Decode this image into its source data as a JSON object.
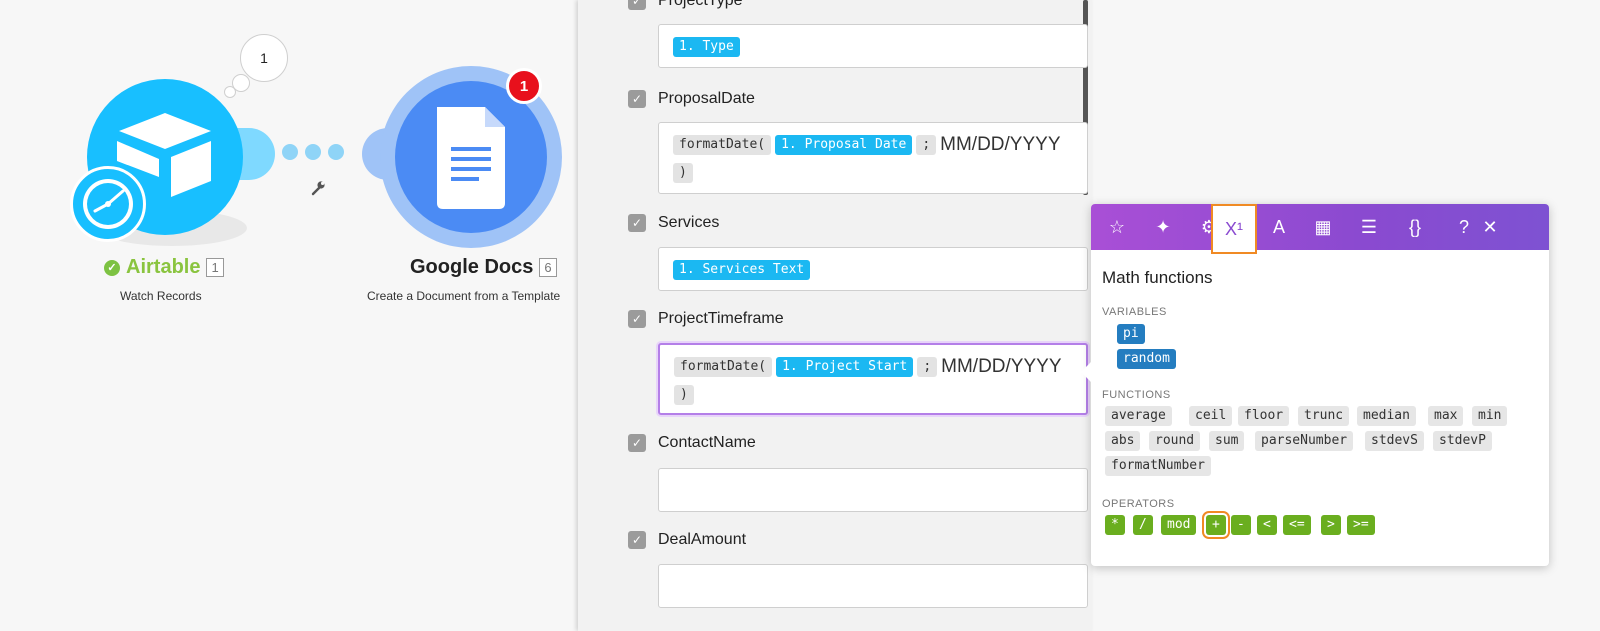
{
  "canvas": {
    "bubble_count": "1",
    "airtable": {
      "name": "Airtable",
      "id": "1",
      "subtitle": "Watch Records",
      "icon": "airtable-box-icon",
      "badge_icon": "clock-icon"
    },
    "google_docs": {
      "name": "Google Docs",
      "id": "6",
      "subtitle": "Create a Document from a Template",
      "notification": "1",
      "icon": "document-icon"
    },
    "link_icon": "wrench-icon"
  },
  "panel": {
    "fields": [
      {
        "label": "ProjectType",
        "tokens": [
          {
            "kind": "blue",
            "text": "1. Type"
          }
        ]
      },
      {
        "label": "ProposalDate",
        "tokens": [
          {
            "kind": "gray",
            "text": "formatDate("
          },
          {
            "kind": "blue",
            "text": "1. Proposal Date"
          },
          {
            "kind": "gray",
            "text": ";"
          },
          {
            "kind": "text",
            "text": "MM/DD/YYYY"
          },
          {
            "kind": "gray",
            "text": ")"
          }
        ]
      },
      {
        "label": "Services",
        "tokens": [
          {
            "kind": "blue",
            "text": "1. Services Text"
          }
        ]
      },
      {
        "label": "ProjectTimeframe",
        "tokens": [
          {
            "kind": "gray",
            "text": "formatDate("
          },
          {
            "kind": "blue",
            "text": "1. Project Start"
          },
          {
            "kind": "gray",
            "text": ";"
          },
          {
            "kind": "text",
            "text": "MM/DD/YYYY"
          },
          {
            "kind": "gray",
            "text": ")"
          }
        ]
      },
      {
        "label": "ContactName",
        "tokens": []
      },
      {
        "label": "DealAmount",
        "tokens": []
      }
    ]
  },
  "popover": {
    "toolbar": [
      {
        "name": "star-icon",
        "glyph": "☆"
      },
      {
        "name": "sparkle-icon",
        "glyph": "✦"
      },
      {
        "name": "gear-icon",
        "glyph": "⚙"
      },
      {
        "name": "math-icon",
        "glyph": "X¹",
        "active": true
      },
      {
        "name": "text-icon",
        "glyph": "A"
      },
      {
        "name": "calendar-icon",
        "glyph": "▦"
      },
      {
        "name": "table-icon",
        "glyph": "☰"
      },
      {
        "name": "braces-icon",
        "glyph": "{}"
      },
      {
        "name": "help-icon",
        "glyph": "?"
      },
      {
        "name": "close-icon",
        "glyph": "✕"
      }
    ],
    "title": "Math functions",
    "variables_title": "VARIABLES",
    "variables": [
      "pi",
      "random"
    ],
    "functions_title": "FUNCTIONS",
    "functions": [
      "average",
      "ceil",
      "floor",
      "trunc",
      "median",
      "max",
      "min",
      "abs",
      "round",
      "sum",
      "parseNumber",
      "stdevS",
      "stdevP",
      "formatNumber"
    ],
    "operators_title": "OPERATORS",
    "operators": [
      "*",
      "/",
      "mod",
      "+",
      "-",
      "<",
      "<=",
      ">",
      ">="
    ],
    "highlighted_operator": "+"
  }
}
